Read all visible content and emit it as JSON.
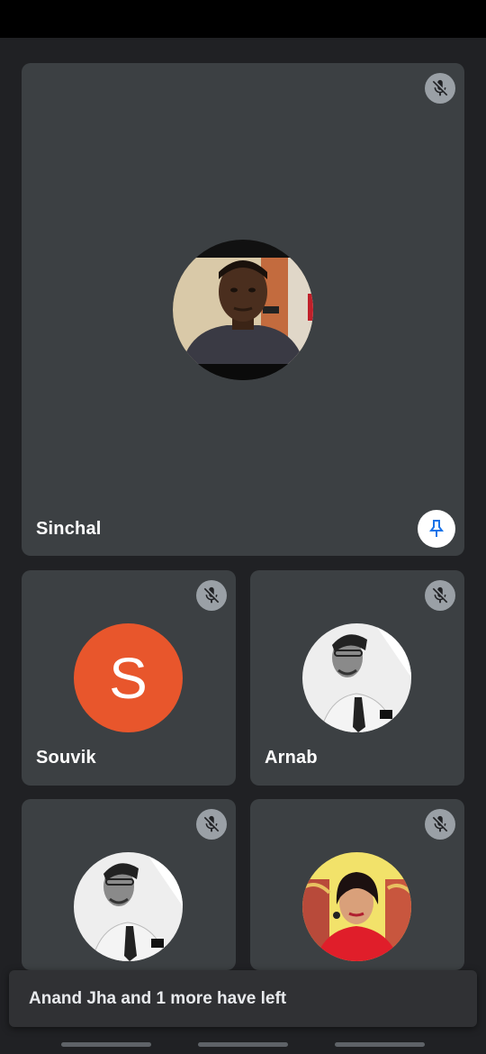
{
  "participants": {
    "main": {
      "name": "Sinchal",
      "muted": true,
      "pinned": true
    },
    "souvik": {
      "name": "Souvik",
      "initial": "S",
      "avatar_color": "#e8562c",
      "muted": true
    },
    "arnab": {
      "name": "Arnab",
      "muted": true
    },
    "tile4": {
      "muted": true
    },
    "tile5": {
      "muted": true
    }
  },
  "snackbar": {
    "message": "Anand Jha and 1 more have left"
  },
  "icons": {
    "mute": "mic-off-icon",
    "pin": "pin-icon"
  },
  "colors": {
    "background": "#202124",
    "tile": "#3c4043",
    "pin_accent": "#1a73e8"
  }
}
